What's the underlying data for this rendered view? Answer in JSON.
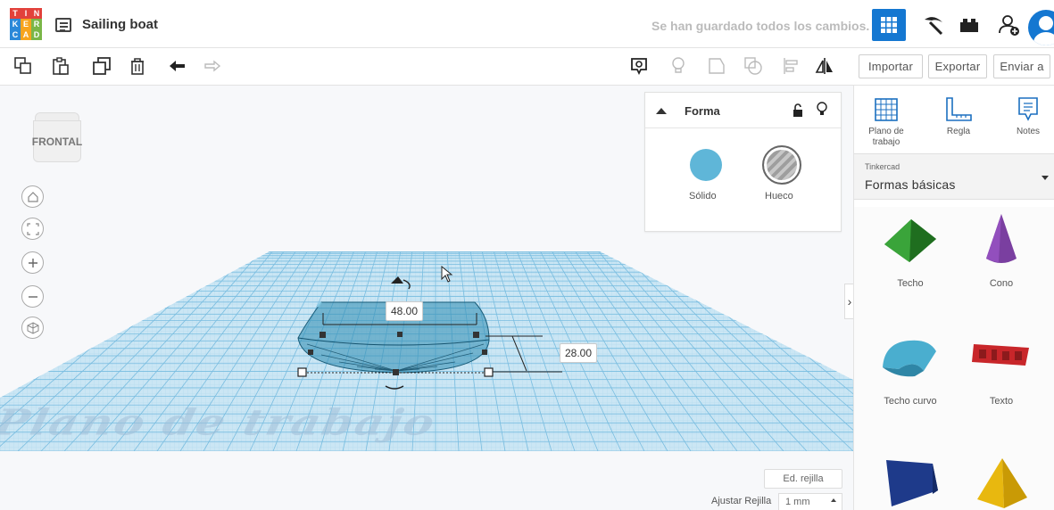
{
  "app": {
    "project_title": "Sailing boat",
    "save_status": "Se han guardado todos los cambios.",
    "logo_letters": [
      "T",
      "I",
      "N",
      "K",
      "E",
      "R",
      "C",
      "A",
      "D"
    ],
    "logo_colors": [
      "#e2413b",
      "#e2413b",
      "#e2413b",
      "#2b88d8",
      "#f7a41d",
      "#7ab648",
      "#2b88d8",
      "#f7a41d",
      "#7ab648"
    ]
  },
  "topbar": {
    "icons": [
      "grid-view-icon",
      "pickaxe-icon",
      "brick-icon",
      "user-add-icon",
      "avatar"
    ],
    "active_color": "#1477d1"
  },
  "toolbar": {
    "edit_tools": [
      "copy-icon",
      "paste-icon",
      "duplicate-icon",
      "delete-icon",
      "undo-icon",
      "redo-icon"
    ],
    "view_tools": [
      "notes-toggle-icon",
      "light-bulb-icon",
      "group-icon",
      "ungroup-icon",
      "align-icon",
      "mirror-icon"
    ],
    "import_label": "Importar",
    "export_label": "Exportar",
    "send_label": "Enviar a"
  },
  "viewcube": {
    "face_label": "FRONTAL"
  },
  "nav_controls": [
    "home-view-icon",
    "fit-view-icon",
    "zoom-in-icon",
    "zoom-out-icon",
    "perspective-icon"
  ],
  "workplane": {
    "label": "Plano de trabajo",
    "grid_color": "#8fc9e8",
    "shape_color": "#2b8bb0",
    "dimensions": {
      "width": "48.00",
      "height": "28.00"
    }
  },
  "grid_controls": {
    "edit_grid_label": "Ed. rejilla",
    "snap_label": "Ajustar Rejilla",
    "snap_value": "1 mm"
  },
  "shape_panel": {
    "title": "Forma",
    "solid_label": "Sólido",
    "hole_label": "Hueco",
    "solid_color": "#5fb6d8"
  },
  "library": {
    "tools": [
      {
        "label": "Plano de trabajo",
        "icon": "workplane-icon"
      },
      {
        "label": "Regla",
        "icon": "ruler-icon"
      },
      {
        "label": "Notes",
        "icon": "notes-icon"
      }
    ],
    "source": "Tinkercad",
    "category": "Formas básicas",
    "shapes": [
      {
        "label": "Techo",
        "color": "#2e8b2e"
      },
      {
        "label": "Cono",
        "color": "#7a3fa0"
      },
      {
        "label": "Techo curvo",
        "color": "#4aaecf"
      },
      {
        "label": "Texto",
        "color": "#c8262a"
      },
      {
        "label": "",
        "color": "#1e3a8a"
      },
      {
        "label": "",
        "color": "#e8b80f"
      }
    ]
  }
}
